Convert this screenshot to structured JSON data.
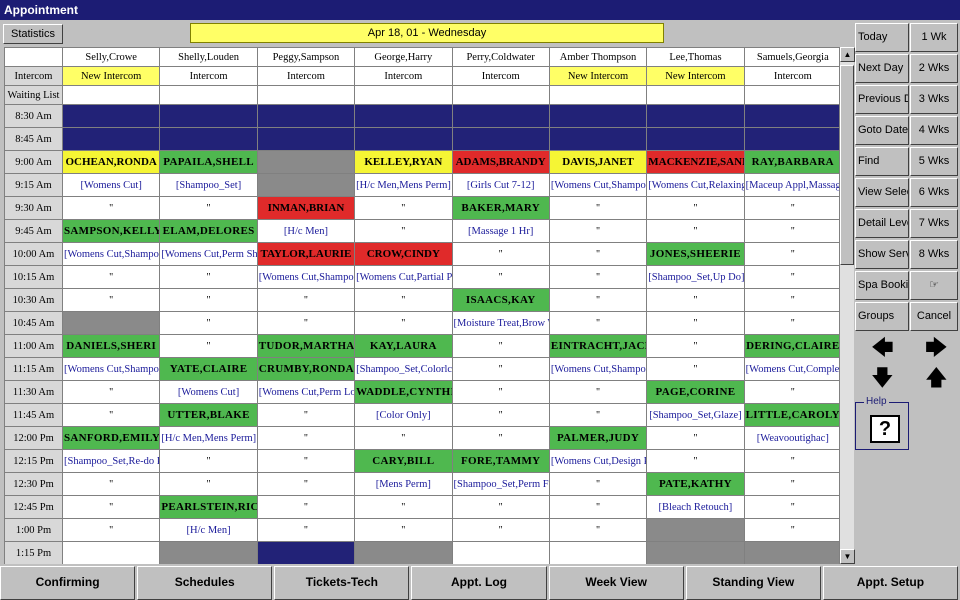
{
  "window": {
    "title": "Appointment"
  },
  "toolbar": {
    "statistics": "Statistics",
    "date": "Apr 18, 01 - Wednesday"
  },
  "columns": [
    "Selly,Crowe",
    "Shelly,Louden",
    "Peggy,Sampson",
    "George,Harry",
    "Perry,Coldwater",
    "Amber Thompson",
    "Lee,Thomas",
    "Samuels,Georgia"
  ],
  "intercom_label": "Intercom",
  "intercom": [
    "New Intercom",
    "Intercom",
    "Intercom",
    "Intercom",
    "Intercom",
    "New Intercom",
    "New Intercom",
    "Intercom"
  ],
  "waiting_label": "Waiting List",
  "schedule": [
    {
      "time": "8:30 Am",
      "cells": [
        [
          "",
          "b"
        ],
        [
          "",
          "b"
        ],
        [
          "",
          "b"
        ],
        [
          "",
          "b"
        ],
        [
          "",
          "b"
        ],
        [
          "",
          "b"
        ],
        [
          "",
          "b"
        ],
        [
          "",
          "b"
        ]
      ]
    },
    {
      "time": "8:45 Am",
      "cells": [
        [
          "",
          "b"
        ],
        [
          "",
          "b"
        ],
        [
          "",
          "b"
        ],
        [
          "",
          "b"
        ],
        [
          "",
          "b"
        ],
        [
          "",
          "b"
        ],
        [
          "",
          "b"
        ],
        [
          "",
          "b"
        ]
      ]
    },
    {
      "time": "9:00 Am",
      "cells": [
        [
          "OCHEAN,RONDA",
          "y"
        ],
        [
          "PAPAILA,SHELL",
          "g"
        ],
        [
          "",
          "x"
        ],
        [
          "KELLEY,RYAN",
          "y"
        ],
        [
          "ADAMS,BRANDY",
          "r"
        ],
        [
          "DAVIS,JANET",
          "y"
        ],
        [
          "MACKENZIE,SAND",
          "r"
        ],
        [
          "RAY,BARBARA",
          "g"
        ]
      ]
    },
    {
      "time": "9:15 Am",
      "cells": [
        [
          "[Womens Cut]",
          "s"
        ],
        [
          "[Shampoo_Set]",
          "s"
        ],
        [
          "",
          "x"
        ],
        [
          "[H/c Men,Mens Perm]",
          "s"
        ],
        [
          "[Girls Cut 7-12]",
          "s"
        ],
        [
          "[Womens Cut,Shampoo",
          "s"
        ],
        [
          "[Womens Cut,Relaxing",
          "s"
        ],
        [
          "[Maceup Appl,Massage",
          "s"
        ]
      ]
    },
    {
      "time": "9:30 Am",
      "cells": [
        [
          "\"",
          "d"
        ],
        [
          "\"",
          "d"
        ],
        [
          "INMAN,BRIAN",
          "r"
        ],
        [
          "\"",
          "d"
        ],
        [
          "BAKER,MARY",
          "g"
        ],
        [
          "\"",
          "d"
        ],
        [
          "\"",
          "d"
        ],
        [
          "\"",
          "d"
        ]
      ]
    },
    {
      "time": "9:45 Am",
      "cells": [
        [
          "SAMPSON,KELLY",
          "g"
        ],
        [
          "ELAM,DELORES",
          "g"
        ],
        [
          "[H/c Men]",
          "s"
        ],
        [
          "\"",
          "d"
        ],
        [
          "[Massage 1 Hr]",
          "s"
        ],
        [
          "\"",
          "d"
        ],
        [
          "\"",
          "d"
        ],
        [
          "\"",
          "d"
        ]
      ]
    },
    {
      "time": "10:00 Am",
      "cells": [
        [
          "[Womens Cut,Shampoo",
          "s"
        ],
        [
          "[Womens Cut,Perm Sho",
          "s"
        ],
        [
          "TAYLOR,LAURIE",
          "r"
        ],
        [
          "CROW,CINDY",
          "r"
        ],
        [
          "\"",
          "d"
        ],
        [
          "\"",
          "d"
        ],
        [
          "JONES,SHEERIE",
          "g"
        ],
        [
          "\"",
          "d"
        ]
      ]
    },
    {
      "time": "10:15 Am",
      "cells": [
        [
          "\"",
          "d"
        ],
        [
          "\"",
          "d"
        ],
        [
          "[Womens Cut,Shampoo",
          "s"
        ],
        [
          "[Womens Cut,Partial Pe",
          "s"
        ],
        [
          "\"",
          "d"
        ],
        [
          "\"",
          "d"
        ],
        [
          "[Shampoo_Set,Up Do]",
          "s"
        ],
        [
          "\"",
          "d"
        ]
      ]
    },
    {
      "time": "10:30 Am",
      "cells": [
        [
          "\"",
          "d"
        ],
        [
          "\"",
          "d"
        ],
        [
          "\"",
          "d"
        ],
        [
          "\"",
          "d"
        ],
        [
          "ISAACS,KAY",
          "g"
        ],
        [
          "\"",
          "d"
        ],
        [
          "\"",
          "d"
        ],
        [
          "\"",
          "d"
        ]
      ]
    },
    {
      "time": "10:45 Am",
      "cells": [
        [
          "",
          "x"
        ],
        [
          "\"",
          "d"
        ],
        [
          "\"",
          "d"
        ],
        [
          "\"",
          "d"
        ],
        [
          "[Moisture Treat,Brow W",
          "s"
        ],
        [
          "\"",
          "d"
        ],
        [
          "\"",
          "d"
        ],
        [
          "\"",
          "d"
        ]
      ]
    },
    {
      "time": "11:00 Am",
      "cells": [
        [
          "DANIELS,SHERI",
          "g"
        ],
        [
          "\"",
          "d"
        ],
        [
          "TUDOR,MARTHA",
          "g"
        ],
        [
          "KAY,LAURA",
          "g"
        ],
        [
          "\"",
          "d"
        ],
        [
          "EINTRACHT,JACKIE",
          "g"
        ],
        [
          "\"",
          "d"
        ],
        [
          "DERING,CLAIRE",
          "g"
        ]
      ]
    },
    {
      "time": "11:15 Am",
      "cells": [
        [
          "[Womens Cut,Shampoo",
          "s"
        ],
        [
          "YATE,CLAIRE",
          "g"
        ],
        [
          "CRUMBY,RONDA",
          "g"
        ],
        [
          "[Shampoo_Set,Colorlcu",
          "s"
        ],
        [
          "\"",
          "d"
        ],
        [
          "[Womens Cut,Shampoo",
          "s"
        ],
        [
          "\"",
          "d"
        ],
        [
          "[Womens Cut,Complex",
          "s"
        ]
      ]
    },
    {
      "time": "11:30 Am",
      "cells": [
        [
          "\"",
          "d"
        ],
        [
          "[Womens Cut]",
          "s"
        ],
        [
          "[Womens Cut,Perm Lor",
          "s"
        ],
        [
          "WADDLE,CYNTHIA",
          "g"
        ],
        [
          "\"",
          "d"
        ],
        [
          "\"",
          "d"
        ],
        [
          "PAGE,CORINE",
          "g"
        ],
        [
          "\"",
          "d"
        ]
      ]
    },
    {
      "time": "11:45 Am",
      "cells": [
        [
          "\"",
          "d"
        ],
        [
          "UTTER,BLAKE",
          "g"
        ],
        [
          "\"",
          "d"
        ],
        [
          "[Color Only]",
          "s"
        ],
        [
          "\"",
          "d"
        ],
        [
          "\"",
          "d"
        ],
        [
          "[Shampoo_Set,Glaze]",
          "s"
        ],
        [
          "LITTLE,CAROLYN",
          "g"
        ]
      ]
    },
    {
      "time": "12:00 Pm",
      "cells": [
        [
          "SANFORD,EMILY",
          "g"
        ],
        [
          "[H/c Men,Mens Perm]",
          "s"
        ],
        [
          "\"",
          "d"
        ],
        [
          "\"",
          "d"
        ],
        [
          "\"",
          "d"
        ],
        [
          "PALMER,JUDY",
          "g"
        ],
        [
          "\"",
          "d"
        ],
        [
          "[Weavooutighac]",
          "s"
        ]
      ]
    },
    {
      "time": "12:15 Pm",
      "cells": [
        [
          "[Shampoo_Set,Re-do Pe",
          "s"
        ],
        [
          "\"",
          "d"
        ],
        [
          "\"",
          "d"
        ],
        [
          "CARY,BILL",
          "g"
        ],
        [
          "FORE,TAMMY",
          "g"
        ],
        [
          "[Womens Cut,Design Pe",
          "s"
        ],
        [
          "\"",
          "d"
        ],
        [
          "\"",
          "d"
        ]
      ]
    },
    {
      "time": "12:30 Pm",
      "cells": [
        [
          "\"",
          "d"
        ],
        [
          "\"",
          "d"
        ],
        [
          "\"",
          "d"
        ],
        [
          "[Mens Perm]",
          "s"
        ],
        [
          "[Shampoo_Set,Perm Fe",
          "s"
        ],
        [
          "\"",
          "d"
        ],
        [
          "PATE,KATHY",
          "g"
        ],
        [
          "\"",
          "d"
        ]
      ]
    },
    {
      "time": "12:45 Pm",
      "cells": [
        [
          "\"",
          "d"
        ],
        [
          "PEARLSTEIN,RICH",
          "g"
        ],
        [
          "\"",
          "d"
        ],
        [
          "\"",
          "d"
        ],
        [
          "\"",
          "d"
        ],
        [
          "\"",
          "d"
        ],
        [
          "[Bleach Retouch]",
          "s"
        ],
        [
          "\"",
          "d"
        ]
      ]
    },
    {
      "time": "1:00 Pm",
      "cells": [
        [
          "\"",
          "d"
        ],
        [
          "[H/c Men]",
          "s"
        ],
        [
          "\"",
          "d"
        ],
        [
          "\"",
          "d"
        ],
        [
          "\"",
          "d"
        ],
        [
          "\"",
          "d"
        ],
        [
          "",
          "x"
        ],
        [
          "\"",
          "d"
        ]
      ]
    },
    {
      "time": "1:15 Pm",
      "cells": [
        [
          "",
          "e"
        ],
        [
          "",
          "x"
        ],
        [
          "",
          "b"
        ],
        [
          "",
          "x"
        ],
        [
          "",
          "e"
        ],
        [
          "",
          "e"
        ],
        [
          "",
          "x"
        ],
        [
          "",
          "x"
        ]
      ]
    }
  ],
  "side_nav": [
    {
      "label": "Today",
      "u": "T",
      "rest": "oday",
      "num": "1 Wk"
    },
    {
      "label": "Next Day",
      "num": "2 Wks"
    },
    {
      "label": "Previous Da",
      "num": "3 Wks"
    },
    {
      "label": "Goto Date",
      "num": "4 Wks"
    },
    {
      "label": "Find",
      "num": "5 Wks"
    },
    {
      "label": "View Select",
      "num": "6 Wks"
    },
    {
      "label": "Detail Level",
      "num": "7 Wks"
    },
    {
      "label": "Show Servi",
      "num": "8 Wks"
    },
    {
      "label": "Spa Booking",
      "num": "☞"
    },
    {
      "label": "Groups",
      "num": "Cancel"
    }
  ],
  "help": {
    "label": "Help",
    "mark": "?"
  },
  "bottom_bar": [
    "Confirming",
    "Schedules",
    "Tickets-Tech",
    "Appt. Log",
    "Week View",
    "Standing View",
    "Appt. Setup"
  ],
  "colors": {
    "title_bar": "#1c1c74",
    "booked_green": "#4fb84f",
    "booked_red": "#e02a2a",
    "booked_yellow": "#f5f534",
    "blocked_blue": "#222277",
    "unavailable_grey": "#8a8a8a"
  }
}
